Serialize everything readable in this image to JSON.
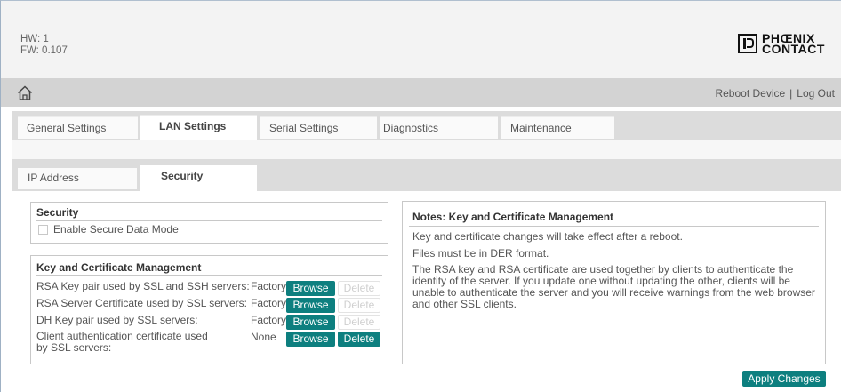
{
  "header": {
    "hw": "HW: 1",
    "fw": "FW: 0.107",
    "logo_line1": "PHŒNIX",
    "logo_line2": "CONTACT"
  },
  "nav": {
    "reboot": "Reboot Device",
    "separator": "|",
    "logout": "Log Out"
  },
  "main_tabs": [
    {
      "label": "General Settings"
    },
    {
      "label": "LAN Settings"
    },
    {
      "label": "Serial Settings"
    },
    {
      "label": "Diagnostics"
    },
    {
      "label": "Maintenance"
    }
  ],
  "sub_tabs": [
    {
      "label": "IP Address"
    },
    {
      "label": "Security"
    }
  ],
  "security": {
    "title": "Security",
    "checkbox_label": "Enable Secure Data Mode"
  },
  "keys": {
    "title": "Key and Certificate Management",
    "rows": [
      {
        "label": "RSA Key pair used by SSL and SSH servers:",
        "value": "Factory",
        "browse": "Browse",
        "delete": "Delete"
      },
      {
        "label": "RSA Server Certificate used by SSL servers:",
        "value": "Factory",
        "browse": "Browse",
        "delete": "Delete"
      },
      {
        "label": "DH Key pair used by SSL servers:",
        "value": "Factory",
        "browse": "Browse",
        "delete": "Delete"
      },
      {
        "label_line1": "Client authentication certificate used",
        "label_line2": "by SSL servers:",
        "value": "None",
        "browse": "Browse",
        "delete": "Delete"
      }
    ]
  },
  "notes": {
    "title": "Notes: Key and Certificate Management",
    "p1": "Key and certificate changes will take effect after a reboot.",
    "p2": "Files must be in DER format.",
    "p3_lines": [
      "The RSA key and RSA certificate are used together by clients to authenticate the",
      "identity of the server. If you update one without updating the other, clients will be",
      "unable to authenticate the server and you will receive warnings from the web browser",
      "and other SSL clients."
    ]
  },
  "apply_label": "Apply Changes",
  "colors": {
    "button": "#0d7f7f",
    "tab_bar": "#dcdcdc",
    "header": "#f3f3f3"
  }
}
